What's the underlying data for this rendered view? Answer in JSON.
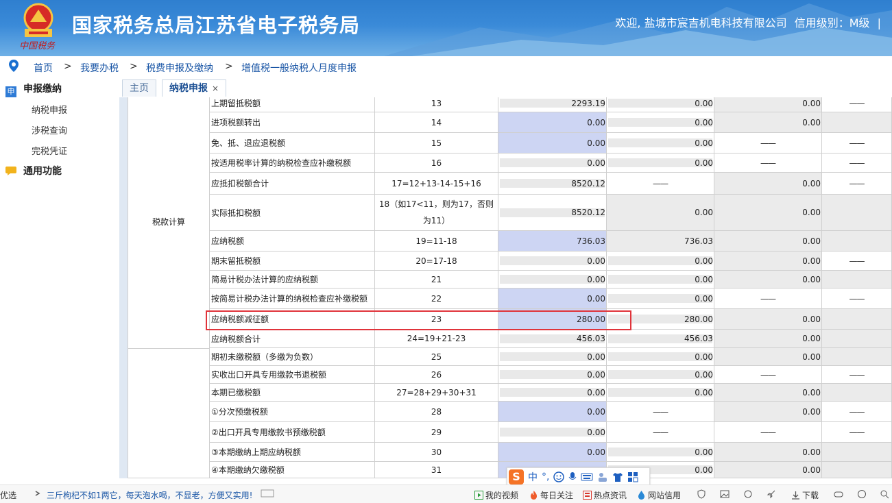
{
  "header": {
    "title": "国家税务总局江苏省电子税务局",
    "emblem_text": "中国税务",
    "welcome": "欢迎, 盐城市宸吉机电科技有限公司",
    "credit": "信用级别：M级",
    "divider": "|"
  },
  "breadcrumb": {
    "items": [
      "首页",
      "我要办税",
      "税费申报及缴纳",
      "增值税一般纳税人月度申报"
    ],
    "separator": ">"
  },
  "sidebar": {
    "group1": "申报缴纳",
    "group1_icon_char": "申",
    "items": [
      "纳税申报",
      "涉税查询",
      "完税凭证"
    ],
    "group2": "通用功能"
  },
  "tabs": [
    {
      "label": "主页",
      "active": false
    },
    {
      "label": "纳税申报",
      "active": true,
      "close": "×"
    }
  ],
  "table": {
    "section1": "税款计算",
    "dash": "——",
    "rows": [
      {
        "name": "上期留抵税额",
        "num": "13",
        "c1": "2293.19",
        "c2": "0.00",
        "c3": "0.00",
        "c4": "——"
      },
      {
        "name": "进项税额转出",
        "num": "14",
        "c1": "0.00",
        "c2": "0.00",
        "c3": "0.00",
        "c4": ""
      },
      {
        "name": "免、抵、退应退税额",
        "num": "15",
        "c1": "0.00",
        "c2": "0.00",
        "c3": "——",
        "c4": "——"
      },
      {
        "name": "按适用税率计算的纳税检查应补缴税额",
        "num": "16",
        "c1": "0.00",
        "c2": "0.00",
        "c3": "——",
        "c4": "——"
      },
      {
        "name": "应抵扣税额合计",
        "num": "17=12+13-14-15+16",
        "c1": "8520.12",
        "c2": "——",
        "c3": "0.00",
        "c4": "——"
      },
      {
        "name": "实际抵扣税额",
        "num": "18（如17<11，则为17，否则为11）",
        "c1": "8520.12",
        "c2": "0.00",
        "c3": "0.00",
        "c4": ""
      },
      {
        "name": "应纳税额",
        "num": "19=11-18",
        "c1": "736.03",
        "c2": "736.03",
        "c3": "0.00",
        "c4": ""
      },
      {
        "name": "期末留抵税额",
        "num": "20=17-18",
        "c1": "0.00",
        "c2": "0.00",
        "c3": "0.00",
        "c4": "——"
      },
      {
        "name": "简易计税办法计算的应纳税额",
        "num": "21",
        "c1": "0.00",
        "c2": "0.00",
        "c3": "0.00",
        "c4": ""
      },
      {
        "name": "按简易计税办法计算的纳税检查应补缴税额",
        "num": "22",
        "c1": "0.00",
        "c2": "0.00",
        "c3": "——",
        "c4": "——"
      },
      {
        "name": "应纳税额减征额",
        "num": "23",
        "c1": "280.00",
        "c2": "280.00",
        "c3": "0.00",
        "c4": ""
      },
      {
        "name": "应纳税额合计",
        "num": "24=19+21-23",
        "c1": "456.03",
        "c2": "456.03",
        "c3": "0.00",
        "c4": ""
      },
      {
        "name": "期初未缴税额（多缴为负数）",
        "num": "25",
        "c1": "0.00",
        "c2": "0.00",
        "c3": "0.00",
        "c4": ""
      },
      {
        "name": "实收出口开具专用缴款书退税额",
        "num": "26",
        "c1": "0.00",
        "c2": "0.00",
        "c3": "——",
        "c4": "——"
      },
      {
        "name": "本期已缴税额",
        "num": "27=28+29+30+31",
        "c1": "0.00",
        "c2": "0.00",
        "c3": "0.00",
        "c4": ""
      },
      {
        "name": "①分次预缴税额",
        "num": "28",
        "c1": "0.00",
        "c2": "——",
        "c3": "0.00",
        "c4": "——"
      },
      {
        "name": "②出口开具专用缴款书预缴税额",
        "num": "29",
        "c1": "0.00",
        "c2": "——",
        "c3": "——",
        "c4": "——"
      },
      {
        "name": "③本期缴纳上期应纳税额",
        "num": "30",
        "c1": "0.00",
        "c2": "0.00",
        "c3": "0.00",
        "c4": ""
      },
      {
        "name": "④本期缴纳欠缴税额",
        "num": "31",
        "c1": "",
        "c2": "0.00",
        "c3": "0.00",
        "c4": ""
      }
    ]
  },
  "ime": {
    "logo": "S",
    "lang": "中",
    "punct": "°,"
  },
  "statusbar": {
    "left": "优选",
    "news": "三斤枸杞不如1两它，每天泡水喝，不显老，方便又实用!",
    "video": "我的视频",
    "follow": "每日关注",
    "hot": "热点资讯",
    "credit": "网站信用",
    "download": "下载"
  },
  "colors": {
    "header_blue": "#2f7fcf",
    "link": "#1a56a6",
    "editable": "#cdd5f3",
    "highlight": "#e0333a"
  }
}
